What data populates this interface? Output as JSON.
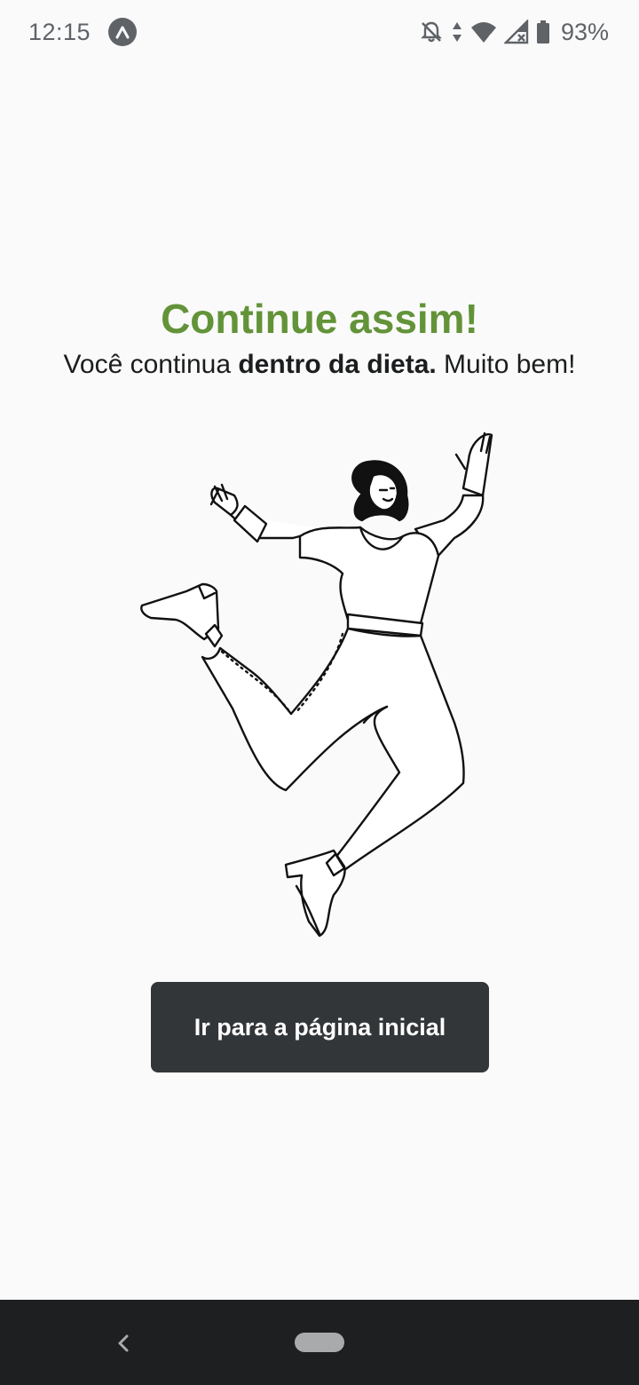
{
  "status_bar": {
    "time": "12:15",
    "app_badge_icon": "app-notification-icon",
    "icons": [
      "notifications-off-icon",
      "data-transfer-icon",
      "wifi-icon",
      "cell-signal-no-service-icon",
      "battery-icon"
    ],
    "battery_percent": "93%"
  },
  "feedback": {
    "title": "Continue assim!",
    "title_color": "#639339",
    "message_prefix": "Você continua ",
    "message_bold": "dentro da dieta.",
    "message_suffix": " Muito bem!"
  },
  "illustration": {
    "icon": "jumping-woman-illustration"
  },
  "actions": {
    "home_button_label": "Ir para a página inicial",
    "home_button_color": "#333638"
  },
  "navigation_bar": {
    "back_icon": "back-icon",
    "home_icon": "home-pill-icon"
  }
}
